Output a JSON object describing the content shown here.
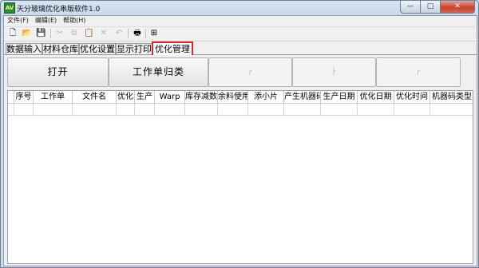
{
  "window": {
    "title": "天分玻璃优化串版软件1.0",
    "icon_text": "AV",
    "controls": [
      "—",
      "□",
      "✕"
    ]
  },
  "menu": [
    "文件(F)",
    "编辑(E)",
    "帮助(H)"
  ],
  "toolbar": {
    "icons": [
      "new-file-icon",
      "open-folder-icon",
      "save-icon",
      "cut-icon",
      "copy-icon",
      "paste-icon",
      "delete-icon",
      "undo-icon",
      "print-icon",
      "grid-icon"
    ],
    "glyphs": [
      "🗋",
      "📂",
      "💾",
      "✂",
      "⧉",
      "📋",
      "✕",
      "↶",
      "🖶",
      "⊞"
    ]
  },
  "tabs": [
    "数据输入",
    "材料仓库",
    "优化设置",
    "显示打印",
    "优化管理"
  ],
  "active_tab": "优化管理",
  "buttons": {
    "open": "打开",
    "classify": "工作单归类",
    "blank1": "┌",
    "blank2": "├",
    "blank3": "┌"
  },
  "table": {
    "columns": [
      "序号",
      "工作单",
      "文件名",
      "优化",
      "生产",
      "Warp",
      "库存减数",
      "余料使用",
      "添小片",
      "产生机器码",
      "生产日期",
      "优化日期",
      "优化时间",
      "机器码类型"
    ],
    "rows": []
  },
  "colors": {
    "active_tab_border": "#d8282a",
    "close_button": "#c8442c"
  }
}
